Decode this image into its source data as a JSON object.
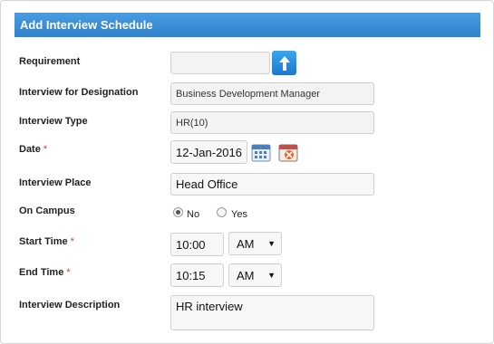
{
  "header": {
    "title": "Add Interview Schedule"
  },
  "labels": {
    "requirement": "Requirement",
    "designation": "Interview for Designation",
    "type": "Interview Type",
    "date": "Date",
    "place": "Interview Place",
    "on_campus": "On Campus",
    "start_time": "Start Time",
    "end_time": "End Time",
    "description": "Interview Description",
    "required_mark": "*"
  },
  "fields": {
    "requirement": "",
    "designation": "Business Development Manager",
    "type": "HR(10)",
    "date": "12-Jan-2016",
    "place": "Head Office",
    "start_time": "10:00",
    "start_ampm": "AM",
    "end_time": "10:15",
    "end_ampm": "AM",
    "description": "HR interview"
  },
  "on_campus": {
    "options": [
      "No",
      "Yes"
    ],
    "selected": "No"
  },
  "icons": {
    "upload": "upload-arrow-icon",
    "calendar": "calendar-icon",
    "clear_date": "clear-date-icon"
  },
  "colors": {
    "header": "#3a8fd6",
    "required": "#e0322f"
  }
}
